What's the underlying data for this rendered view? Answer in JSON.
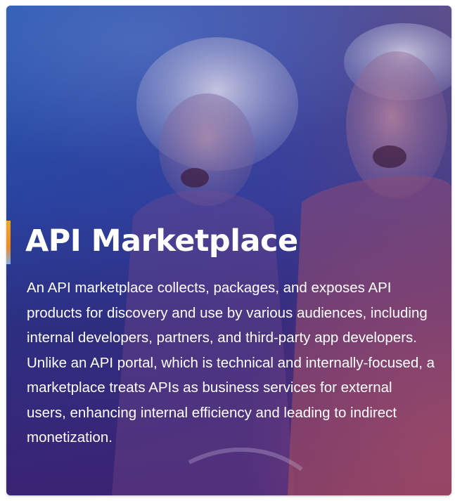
{
  "card": {
    "title": "API Marketplace",
    "description": "An API marketplace collects, packages, and exposes API products for discovery and use by various audiences, including internal developers, partners, and third-party app developers. Unlike an API portal, which is technical and internally-focused, a marketplace treats APIs as business services for external users, enhancing internal efficiency and leading to indirect monetization."
  },
  "colors": {
    "overlay_top": "#2a62b8",
    "overlay_bottom_right": "#9a4d63",
    "accent_bar": "#f5a524",
    "text": "#ffffff"
  }
}
